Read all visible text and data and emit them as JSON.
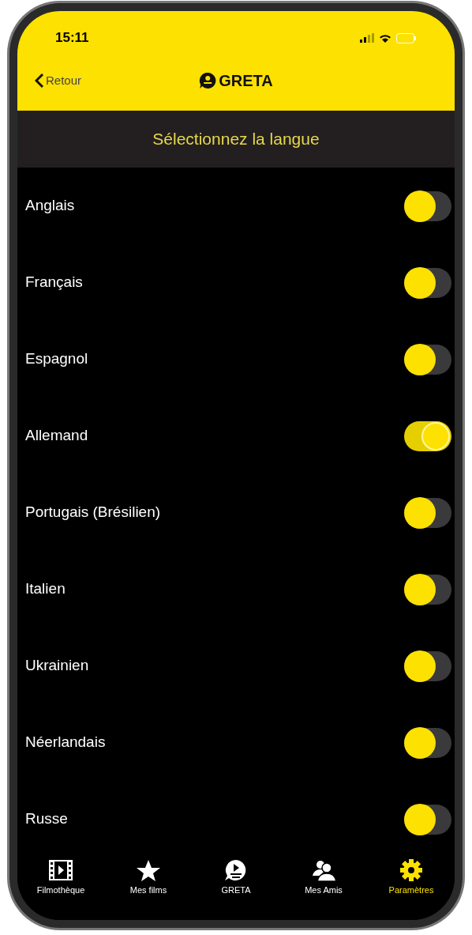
{
  "status_bar": {
    "time": "15:11"
  },
  "nav": {
    "back": "Retour",
    "title": "GRETA"
  },
  "header": {
    "title": "Sélectionnez la langue"
  },
  "languages": [
    {
      "label": "Anglais",
      "on": false
    },
    {
      "label": "Français",
      "on": false
    },
    {
      "label": "Espagnol",
      "on": false
    },
    {
      "label": "Allemand",
      "on": true
    },
    {
      "label": "Portugais (Brésilien)",
      "on": false
    },
    {
      "label": "Italien",
      "on": false
    },
    {
      "label": "Ukrainien",
      "on": false
    },
    {
      "label": "Néerlandais",
      "on": false
    },
    {
      "label": "Russe",
      "on": false
    }
  ],
  "tab_bar": [
    {
      "label": "Filmothèque",
      "kind": "film",
      "selected": false
    },
    {
      "label": "Mes films",
      "kind": "star",
      "selected": false
    },
    {
      "label": "GRETA",
      "kind": "greta",
      "selected": false
    },
    {
      "label": "Mes Amis",
      "kind": "friends",
      "selected": false
    },
    {
      "label": "Paramètres",
      "kind": "gear",
      "selected": true
    }
  ]
}
